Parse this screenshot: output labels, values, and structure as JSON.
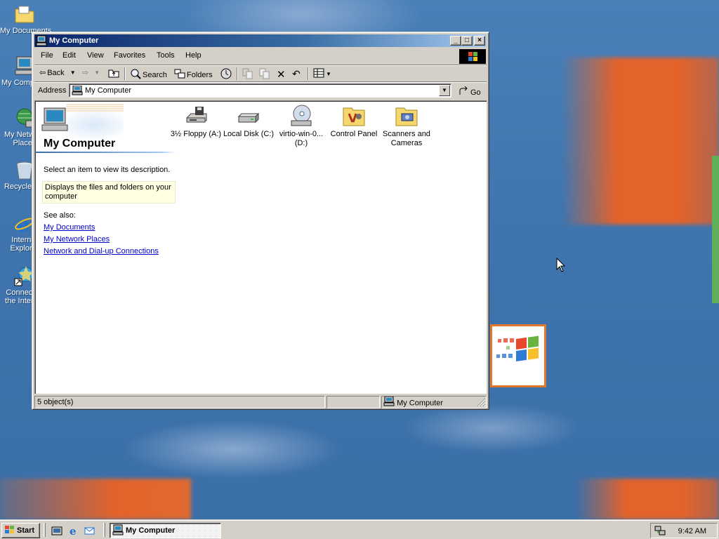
{
  "desktop": {
    "icons": [
      {
        "label": "My Documents",
        "icon": "my-documents-folder-icon"
      },
      {
        "label": "My Computer",
        "icon": "my-computer-icon"
      },
      {
        "label": "My Network Places",
        "icon": "network-places-icon"
      },
      {
        "label": "Recycle Bin",
        "icon": "recycle-bin-icon"
      },
      {
        "label": "Internet Explorer",
        "icon": "internet-explorer-icon"
      },
      {
        "label": "Connect to the Internet",
        "icon": "connect-internet-icon"
      }
    ],
    "background_color": "#3a6ea5",
    "accent_orange": "#e4632a"
  },
  "window": {
    "title": "My Computer",
    "controls": {
      "minimize": "_",
      "maximize": "□",
      "close": "×"
    },
    "menu": [
      "File",
      "Edit",
      "View",
      "Favorites",
      "Tools",
      "Help"
    ],
    "toolbar": {
      "back": "Back",
      "search": "Search",
      "folders": "Folders"
    },
    "address": {
      "label": "Address",
      "value": "My Computer",
      "go": "Go"
    },
    "left_pane": {
      "title": "My Computer",
      "prompt": "Select an item to view its description.",
      "description": "Displays the files and folders on your computer",
      "see_also": "See also:",
      "links": [
        "My Documents",
        "My Network Places",
        "Network and Dial-up Connections"
      ]
    },
    "items": [
      {
        "label": "3½ Floppy (A:)",
        "icon": "floppy-drive-icon"
      },
      {
        "label": "Local Disk (C:)",
        "icon": "hard-disk-icon"
      },
      {
        "label": "virtio-win-0... (D:)",
        "icon": "cd-drive-icon"
      },
      {
        "label": "Control Panel",
        "icon": "control-panel-icon"
      },
      {
        "label": "Scanners and Cameras",
        "icon": "scanners-cameras-icon"
      }
    ],
    "status": {
      "objects": "5 object(s)",
      "zone": "My Computer"
    },
    "titlebar_color": "#0a246a"
  },
  "taskbar": {
    "start": "Start",
    "task": "My Computer",
    "clock": "9:42 AM"
  }
}
